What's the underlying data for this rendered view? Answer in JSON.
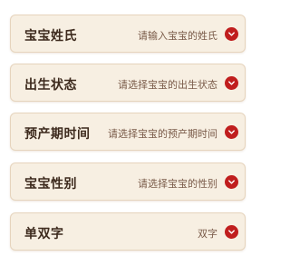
{
  "form": {
    "rows": [
      {
        "label": "宝宝姓氏",
        "placeholder": "请输入宝宝的姓氏"
      },
      {
        "label": "出生状态",
        "placeholder": "请选择宝宝的出生状态"
      },
      {
        "label": "预产期时间",
        "placeholder": "请选择宝宝的预产期时间"
      },
      {
        "label": "宝宝性别",
        "placeholder": "请选择宝宝的性别"
      },
      {
        "label": "单双字",
        "placeholder": "双字"
      }
    ]
  },
  "icons": {
    "chevron": "chevron-down-icon"
  },
  "colors": {
    "accent": "#c01e1e",
    "row_bg": "#f7efe2",
    "label": "#3d2a1d"
  }
}
